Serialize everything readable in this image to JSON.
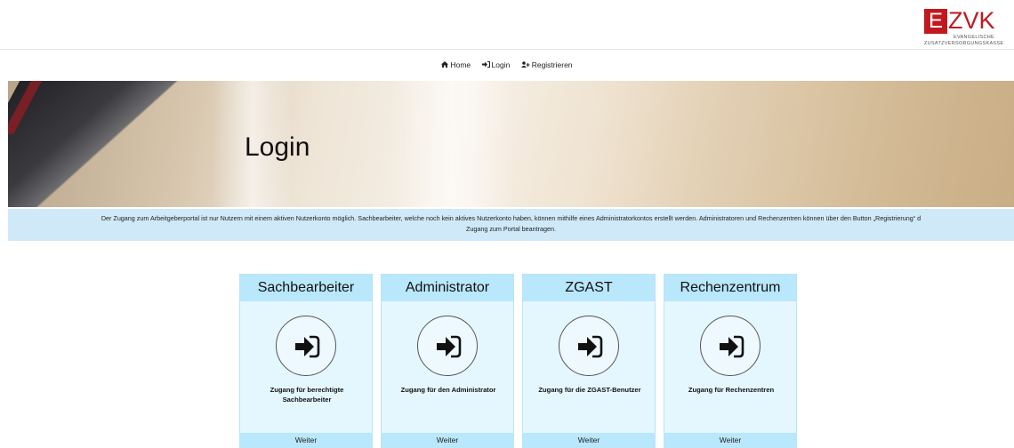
{
  "logo": {
    "letter": "E",
    "name": "ZVK",
    "line1": "EVANGELISCHE",
    "line2": "ZUSATZVERSORGUNGSKASSE",
    "color": "#c2191f"
  },
  "nav": {
    "items": [
      {
        "label": "Home",
        "icon": "home-icon"
      },
      {
        "label": "Login",
        "icon": "sign-in-icon"
      },
      {
        "label": "Registrieren",
        "icon": "user-plus-icon"
      }
    ]
  },
  "hero": {
    "title": "Login"
  },
  "info": {
    "text": "Der Zugang zum Arbeitgeberportal ist nur Nutzern mit einem aktiven Nutzerkonto möglich. Sachbearbeiter, welche noch kein aktives Nutzerkonto haben, können mithilfe eines Administratorkontos erstellt werden. Administratoren und Rechenzentren können über den Button „Registrierung“ d",
    "text2": "Zugang zum Portal beantragen."
  },
  "cards": [
    {
      "title": "Sachbearbeiter",
      "desc": "Zugang für berechtigte Sachbearbeiter",
      "button": "Weiter",
      "icon": "sign-in-icon"
    },
    {
      "title": "Administrator",
      "desc": "Zugang für den Administrator",
      "button": "Weiter",
      "icon": "sign-in-icon"
    },
    {
      "title": "ZGAST",
      "desc": "Zugang für die ZGAST-Benutzer",
      "button": "Weiter",
      "icon": "sign-in-icon"
    },
    {
      "title": "Rechenzentrum",
      "desc": "Zugang für Rechenzentren",
      "button": "Weiter",
      "icon": "sign-in-icon"
    }
  ],
  "colors": {
    "accent_light": "#e4f7ff",
    "accent": "#b9e7fb",
    "info_bg": "#cfe9f8"
  }
}
